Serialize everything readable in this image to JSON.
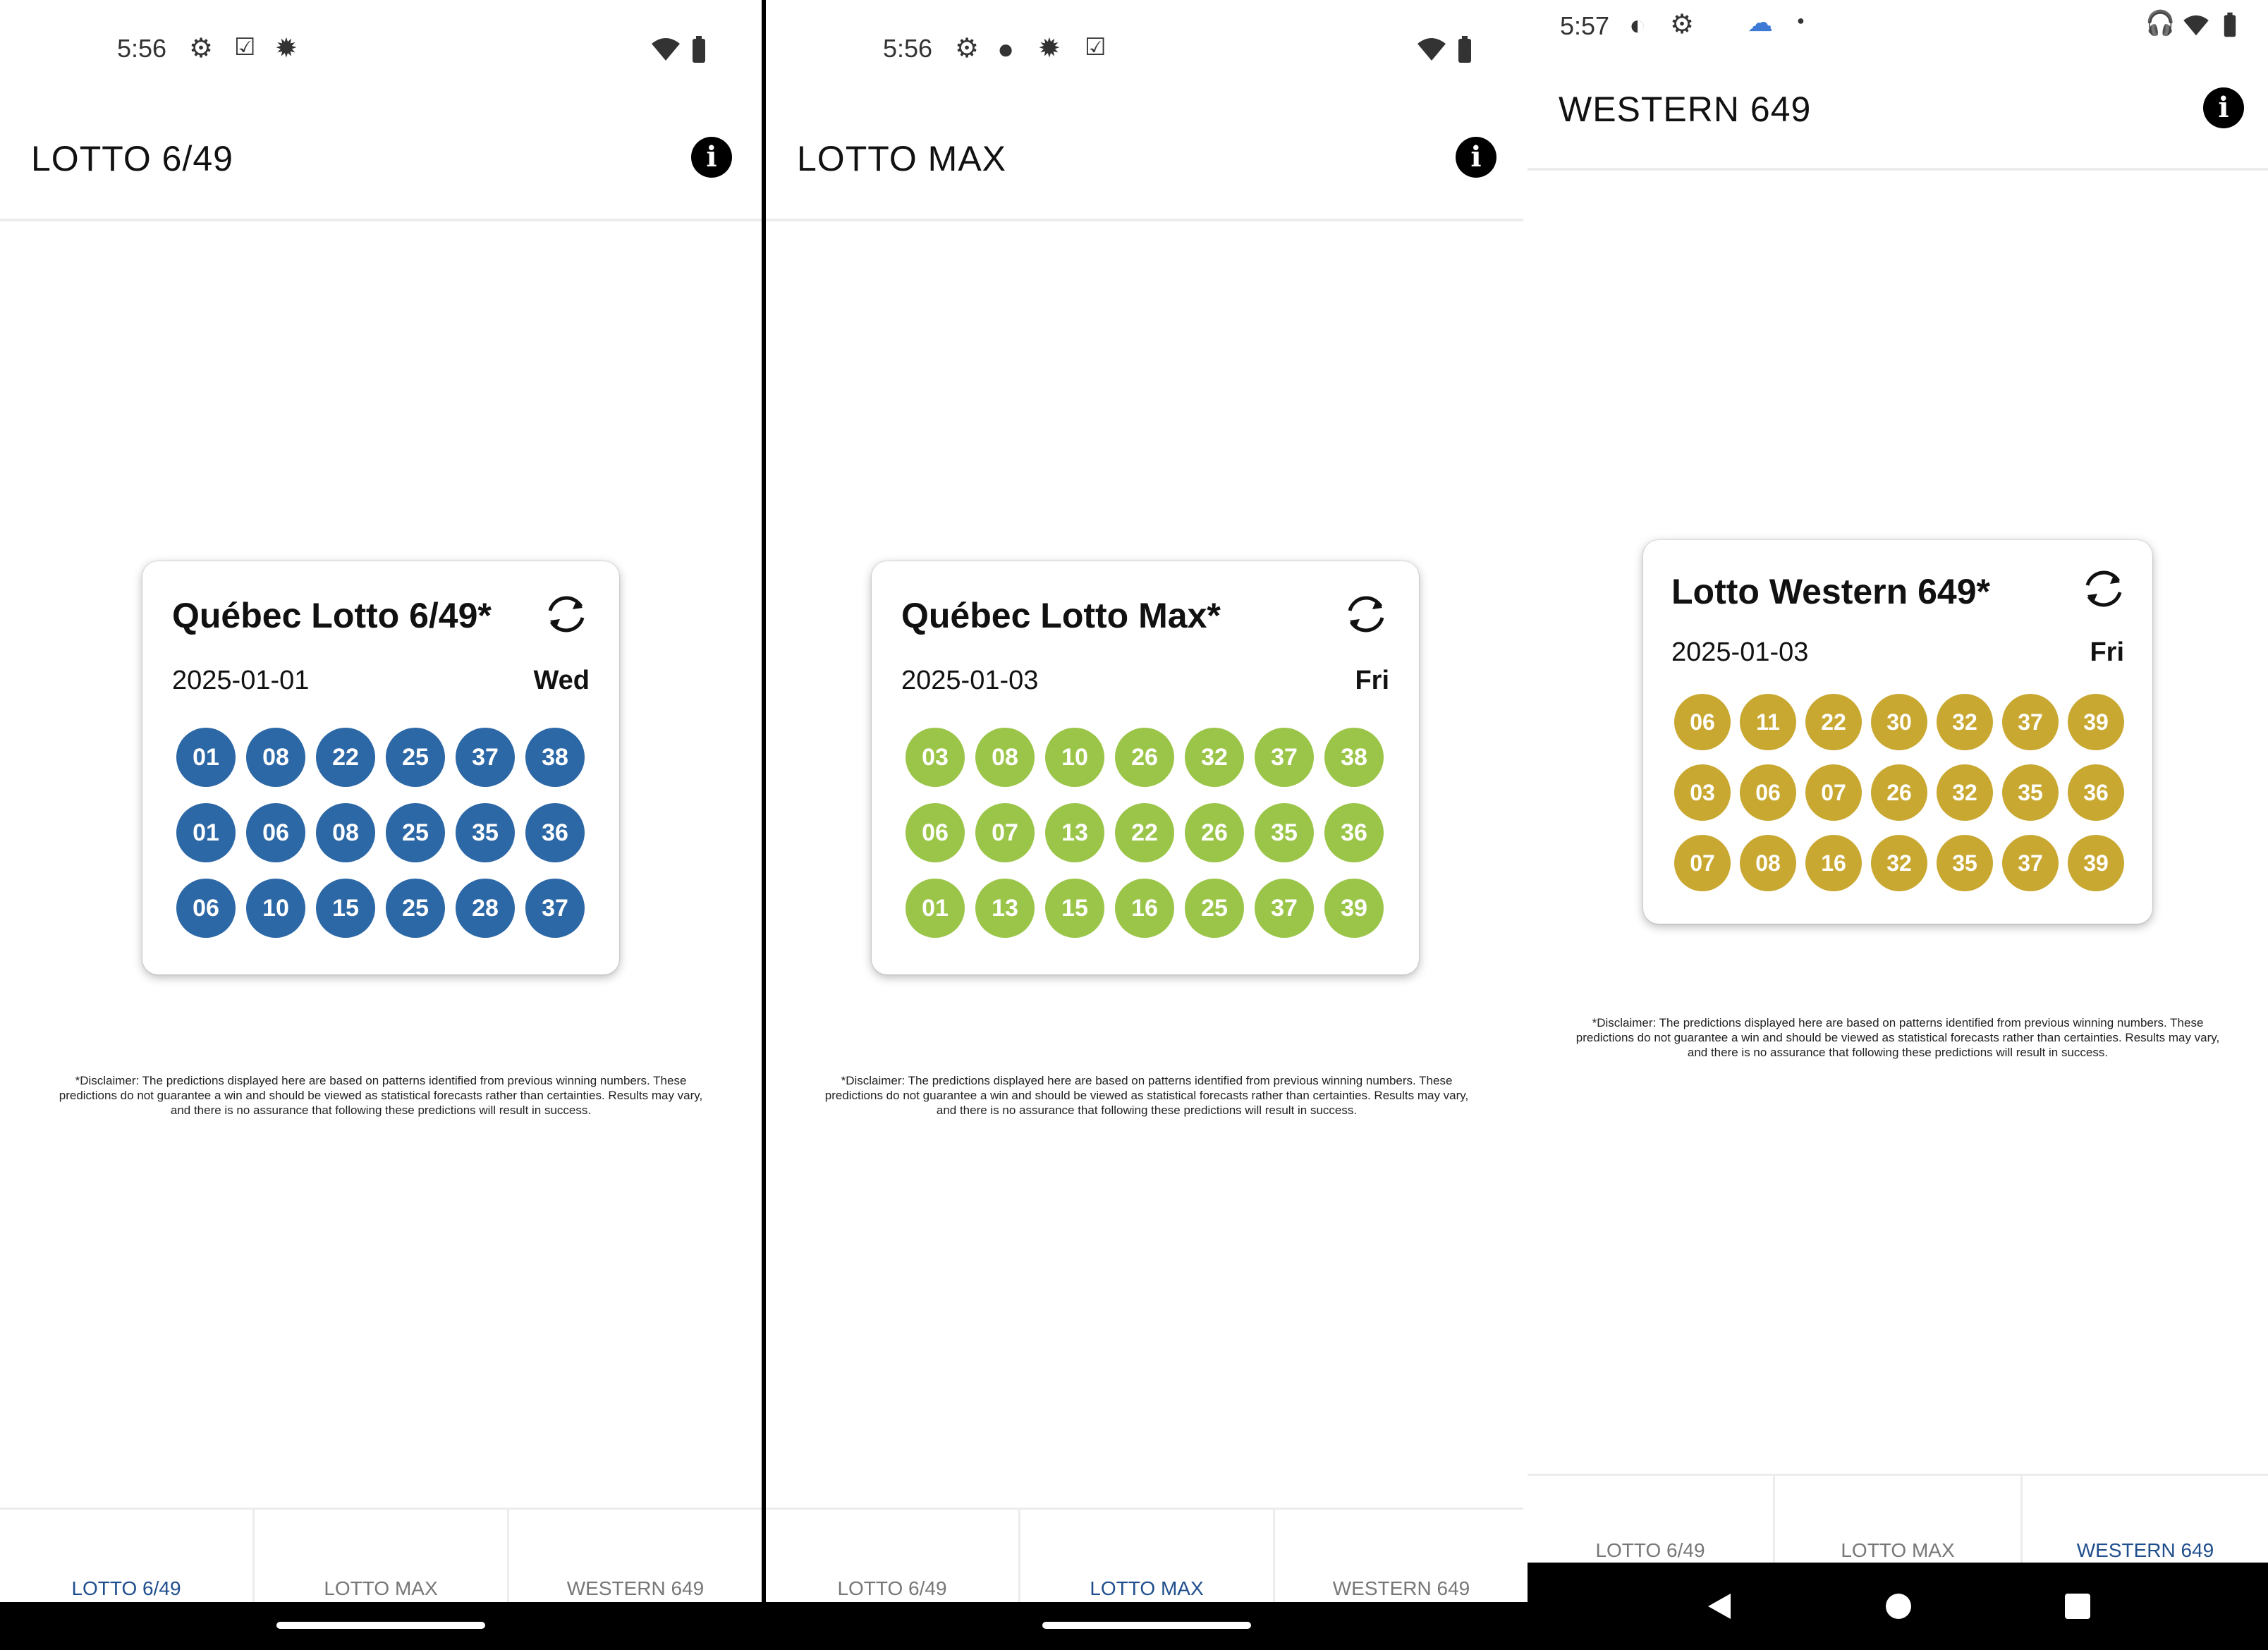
{
  "panels": [
    {
      "status_time": "5:56",
      "app_title": "LOTTO 6/49",
      "card": {
        "title": "Québec Lotto 6/49*",
        "date": "2025-01-01",
        "day": "Wed",
        "ball_color": "#2c67a6",
        "rows": [
          [
            "01",
            "08",
            "22",
            "25",
            "37",
            "38"
          ],
          [
            "01",
            "06",
            "08",
            "25",
            "35",
            "36"
          ],
          [
            "06",
            "10",
            "15",
            "25",
            "28",
            "37"
          ]
        ]
      },
      "disclaimer": "*Disclaimer: The predictions displayed here are based on patterns identified from previous winning numbers. These predictions do not guarantee a win and should be viewed as statistical forecasts rather than certainties. Results may vary, and there is no assurance that following these predictions will result in success.",
      "tabs": [
        {
          "label": "LOTTO 6/49",
          "active": true
        },
        {
          "label": "LOTTO MAX",
          "active": false
        },
        {
          "label": "WESTERN 649",
          "active": false
        }
      ]
    },
    {
      "status_time": "5:56",
      "app_title": "LOTTO MAX",
      "card": {
        "title": "Québec Lotto Max*",
        "date": "2025-01-03",
        "day": "Fri",
        "ball_color": "#9bc548",
        "rows": [
          [
            "03",
            "08",
            "10",
            "26",
            "32",
            "37",
            "38"
          ],
          [
            "06",
            "07",
            "13",
            "22",
            "26",
            "35",
            "36"
          ],
          [
            "01",
            "13",
            "15",
            "16",
            "25",
            "37",
            "39"
          ]
        ]
      },
      "disclaimer": "*Disclaimer: The predictions displayed here are based on patterns identified from previous winning numbers. These predictions do not guarantee a win and should be viewed as statistical forecasts rather than certainties. Results may vary, and there is no assurance that following these predictions will result in success.",
      "tabs": [
        {
          "label": "LOTTO 6/49",
          "active": false
        },
        {
          "label": "LOTTO MAX",
          "active": true
        },
        {
          "label": "WESTERN 649",
          "active": false
        }
      ]
    },
    {
      "status_time": "5:57",
      "app_title": "WESTERN 649",
      "card": {
        "title": "Lotto Western 649*",
        "date": "2025-01-03",
        "day": "Fri",
        "ball_color": "#c9a831",
        "rows": [
          [
            "06",
            "11",
            "22",
            "30",
            "32",
            "37",
            "39"
          ],
          [
            "03",
            "06",
            "07",
            "26",
            "32",
            "35",
            "36"
          ],
          [
            "07",
            "08",
            "16",
            "32",
            "35",
            "37",
            "39"
          ]
        ]
      },
      "disclaimer": "*Disclaimer: The predictions displayed here are based on patterns identified from previous winning numbers. These predictions do not guarantee a win and should be viewed as statistical forecasts rather than certainties. Results may vary, and there is no assurance that following these predictions will result in success.",
      "tabs": [
        {
          "label": "LOTTO 6/49",
          "active": false
        },
        {
          "label": "LOTTO MAX",
          "active": false
        },
        {
          "label": "WESTERN 649",
          "active": true
        }
      ]
    }
  ],
  "colors": {
    "active_tab": "#1f4e8c",
    "inactive_tab": "#777777"
  },
  "icons": {
    "status": [
      "gear-icon",
      "clipboard-check-icon",
      "settings-cog-icon",
      "dot-icon",
      "wifi-icon",
      "battery-icon",
      "headphones-icon",
      "weather-icon"
    ],
    "app": [
      "info-icon",
      "refresh-icon"
    ],
    "nav": [
      "back-icon",
      "home-icon",
      "recents-icon"
    ]
  }
}
